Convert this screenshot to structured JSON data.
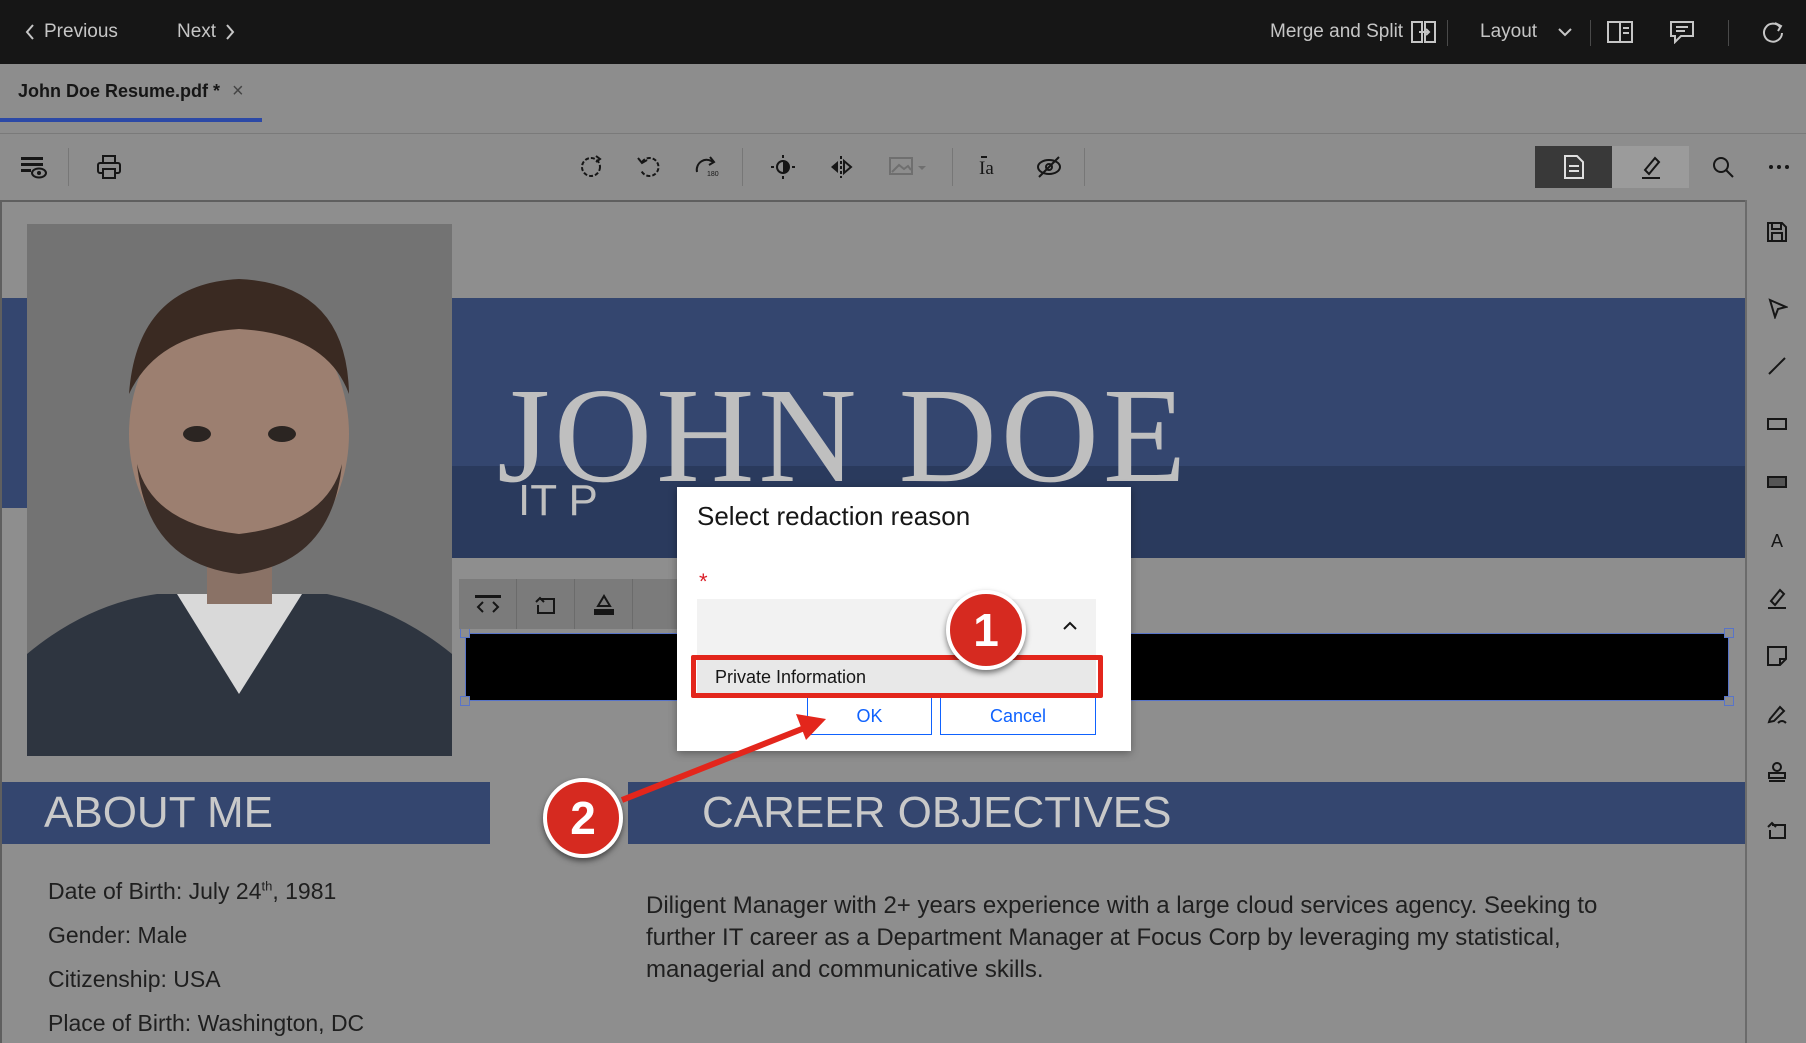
{
  "topbar": {
    "previous_label": "Previous",
    "next_label": "Next",
    "merge_split_label": "Merge and Split",
    "layout_label": "Layout"
  },
  "tab": {
    "title": "John Doe Resume.pdf *",
    "close_glyph": "×"
  },
  "toolbar_icons": [
    "menu-visibility-icon",
    "print-icon",
    "rotate-icon",
    "rotate-left-icon",
    "rotate-right-icon",
    "brightness-icon",
    "flip-icon",
    "image-adjust-icon",
    "text-recognition-icon",
    "hide-icon",
    "document-view-icon",
    "annotate-icon",
    "search-icon",
    "overflow-menu-icon"
  ],
  "right_rail_icons": [
    "save-icon",
    "select-arrow-icon",
    "line-icon",
    "rectangle-outline-icon",
    "rectangle-fill-icon",
    "text-icon",
    "highlighter-icon",
    "sticky-note-icon",
    "signature-icon",
    "stamp-icon",
    "undo-icon"
  ],
  "document": {
    "name": "JOHN DOE",
    "subtitle_partial": "IT P",
    "about_title": "ABOUT ME",
    "career_title": "CAREER OBJECTIVES",
    "info": {
      "dob_prefix": "Date of Birth: July 24",
      "dob_sup": "th",
      "dob_suffix": ", 1981",
      "gender": "Gender: Male",
      "citizenship": "Citizenship: USA",
      "birthplace": "Place of Birth: Washington, DC"
    },
    "career_text": "Diligent Manager with 2+ years experience with a large cloud services agency. Seeking to further IT career as a Department Manager at Focus Corp  by leveraging my statistical, managerial and communicative skills."
  },
  "dialog": {
    "title": "Select redaction reason",
    "required_mark": "*",
    "option": "Private Information",
    "ok_label": "OK",
    "cancel_label": "Cancel"
  },
  "callouts": {
    "step1": "1",
    "step2": "2",
    "color": "#d62a20"
  },
  "colors": {
    "header_band": "#34466f",
    "accent_blue": "#0f62fe",
    "tab_underline": "#2c49a6"
  }
}
